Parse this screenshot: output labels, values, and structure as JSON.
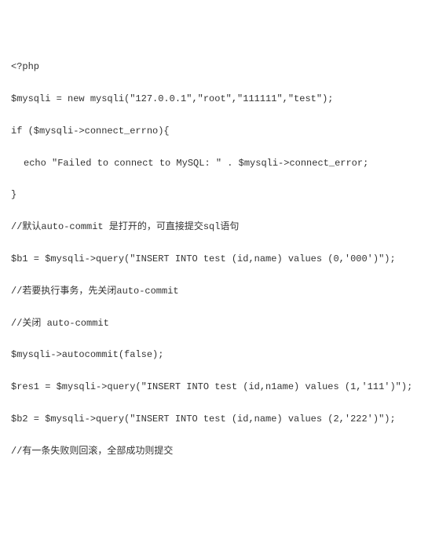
{
  "code": {
    "lines": [
      {
        "text": "<?php",
        "indent": false
      },
      {
        "text": "$mysqli = new mysqli(\"127.0.0.1\",\"root\",\"111111\",\"test\");",
        "indent": false
      },
      {
        "text": "if ($mysqli->connect_errno){",
        "indent": false
      },
      {
        "text": "echo \"Failed to connect to MySQL: \" . $mysqli->connect_error;",
        "indent": true
      },
      {
        "text": "}",
        "indent": false
      },
      {
        "text": "//默认auto-commit 是打开的，可直接提交sql语句",
        "indent": false
      },
      {
        "text": "$b1 = $mysqli->query(\"INSERT INTO test (id,name) values (0,'000')\");",
        "indent": false
      },
      {
        "text": "//若要执行事务，先关闭auto-commit",
        "indent": false
      },
      {
        "text": "//关闭 auto-commit",
        "indent": false
      },
      {
        "text": "$mysqli->autocommit(false);",
        "indent": false
      },
      {
        "text": "$res1 = $mysqli->query(\"INSERT INTO test (id,n1ame) values (1,'111')\");",
        "indent": false
      },
      {
        "text": "$b2 = $mysqli->query(\"INSERT INTO test (id,name) values (2,'222')\");",
        "indent": false
      },
      {
        "text": "//有一条失败则回滚，全部成功则提交",
        "indent": false
      }
    ]
  }
}
